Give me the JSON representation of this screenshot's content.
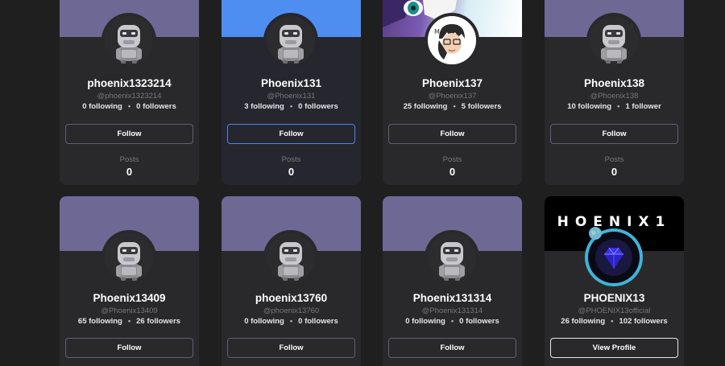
{
  "cards": [
    {
      "name": "phoenix1323214",
      "handle": "@phoenix1323214",
      "following": "0 following",
      "followers": "0 followers",
      "button": "Follow",
      "posts_label": "Posts",
      "posts": "0"
    },
    {
      "name": "Phoenix131",
      "handle": "@Phoenix131",
      "following": "3 following",
      "followers": "0 followers",
      "button": "Follow",
      "posts_label": "Posts",
      "posts": "0"
    },
    {
      "name": "Phoenix137",
      "handle": "@Phoenix137",
      "following": "25 following",
      "followers": "5 followers",
      "button": "Follow",
      "posts_label": "Posts",
      "posts": "0"
    },
    {
      "name": "Phoenix138",
      "handle": "@Phoenix138",
      "following": "10 following",
      "followers": "1 follower",
      "button": "Follow",
      "posts_label": "Posts",
      "posts": "0"
    },
    {
      "name": "Phoenix13409",
      "handle": "@Phoenix13409",
      "following": "65 following",
      "followers": "26 followers",
      "button": "Follow"
    },
    {
      "name": "phoenix13760",
      "handle": "@phoenix13760",
      "following": "0 following",
      "followers": "0 followers",
      "button": "Follow"
    },
    {
      "name": "Phoenix131314",
      "handle": "@Phoenix131314",
      "following": "0 following",
      "followers": "0 followers",
      "button": "Follow"
    },
    {
      "name": "PHOENIX13",
      "handle": "@PHOENIX13official",
      "following": "26 following",
      "followers": "102 followers",
      "button": "View Profile",
      "banner_text": "HOENIX1"
    }
  ],
  "separator": "•",
  "colors": {
    "page_bg": "#1f1f20",
    "card_bg": "#29292b",
    "banner_default": "#6d6894",
    "banner_blue": "#4e8ef0",
    "follow_border": "#5e5e79",
    "active_border": "#4a86e8"
  }
}
